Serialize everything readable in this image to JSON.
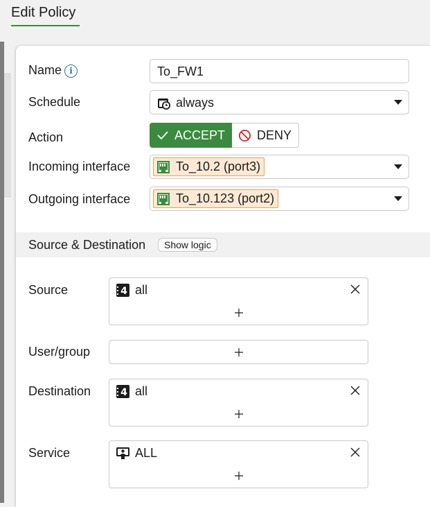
{
  "page": {
    "title": "Edit Policy"
  },
  "form": {
    "name": {
      "label": "Name",
      "value": "To_FW1"
    },
    "schedule": {
      "label": "Schedule",
      "value": "always"
    },
    "action": {
      "label": "Action",
      "accept_label": "ACCEPT",
      "deny_label": "DENY",
      "selected": "ACCEPT"
    },
    "incoming": {
      "label": "Incoming interface",
      "value": "To_10.2 (port3)"
    },
    "outgoing": {
      "label": "Outgoing interface",
      "value": "To_10.123 (port2)"
    }
  },
  "section": {
    "title": "Source & Destination",
    "show_logic_label": "Show logic"
  },
  "source": {
    "label": "Source",
    "entries": [
      "all"
    ]
  },
  "user_group": {
    "label": "User/group",
    "entries": []
  },
  "destination": {
    "label": "Destination",
    "entries": [
      "all"
    ]
  },
  "service": {
    "label": "Service",
    "entries": [
      "ALL"
    ]
  },
  "colors": {
    "accent_green": "#3a8a3f",
    "info_blue": "#2d6ea6",
    "deny_red": "#d9302b",
    "chip_border": "#e8a24a",
    "chip_bg": "#fde9d6"
  },
  "icons": {
    "info": "info-icon",
    "schedule": "schedule-icon",
    "accept": "check-icon",
    "deny": "no-entry-icon",
    "port": "port-icon",
    "address": "ipv4-address-icon",
    "service": "service-icon",
    "remove": "close-icon",
    "add": "plus-icon"
  }
}
